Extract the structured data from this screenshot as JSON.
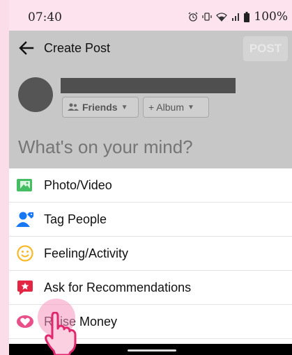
{
  "status_bar": {
    "time": "07:40",
    "battery": "100%",
    "icons": [
      "alarm-icon",
      "vibrate-icon",
      "wifi-icon",
      "signal-icon",
      "battery-icon"
    ]
  },
  "header": {
    "title": "Create Post",
    "post_label": "POST"
  },
  "composer": {
    "friends_label": "Friends",
    "album_label": "+ Album",
    "prompt": "What's on your mind?"
  },
  "menu": [
    {
      "label": "Photo/Video",
      "icon": "photo-icon",
      "color": "#45bd62"
    },
    {
      "label": "Tag People",
      "icon": "tag-people-icon",
      "color": "#1877f2"
    },
    {
      "label": "Feeling/Activity",
      "icon": "feeling-icon",
      "color": "#f7b928"
    },
    {
      "label": "Ask for Recommendations",
      "icon": "recommendations-icon",
      "color": "#e42645"
    },
    {
      "label": "Raise Money",
      "icon": "raise-money-icon",
      "color": "#e8508a"
    }
  ],
  "colors": {
    "background": "#fbdce9",
    "dim_overlay": "#c7c7c7"
  }
}
